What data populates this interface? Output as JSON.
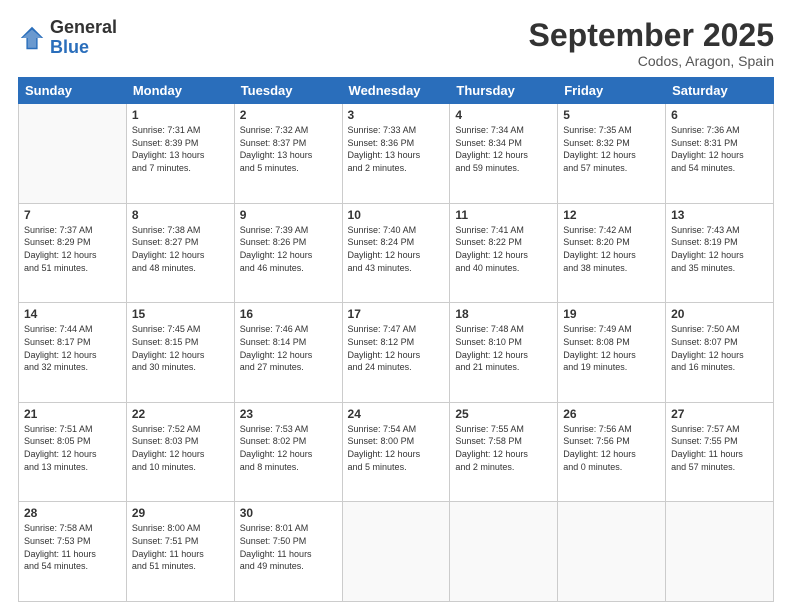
{
  "logo": {
    "general": "General",
    "blue": "Blue"
  },
  "header": {
    "month": "September 2025",
    "location": "Codos, Aragon, Spain"
  },
  "weekdays": [
    "Sunday",
    "Monday",
    "Tuesday",
    "Wednesday",
    "Thursday",
    "Friday",
    "Saturday"
  ],
  "weeks": [
    [
      {
        "day": "",
        "info": ""
      },
      {
        "day": "1",
        "info": "Sunrise: 7:31 AM\nSunset: 8:39 PM\nDaylight: 13 hours\nand 7 minutes."
      },
      {
        "day": "2",
        "info": "Sunrise: 7:32 AM\nSunset: 8:37 PM\nDaylight: 13 hours\nand 5 minutes."
      },
      {
        "day": "3",
        "info": "Sunrise: 7:33 AM\nSunset: 8:36 PM\nDaylight: 13 hours\nand 2 minutes."
      },
      {
        "day": "4",
        "info": "Sunrise: 7:34 AM\nSunset: 8:34 PM\nDaylight: 12 hours\nand 59 minutes."
      },
      {
        "day": "5",
        "info": "Sunrise: 7:35 AM\nSunset: 8:32 PM\nDaylight: 12 hours\nand 57 minutes."
      },
      {
        "day": "6",
        "info": "Sunrise: 7:36 AM\nSunset: 8:31 PM\nDaylight: 12 hours\nand 54 minutes."
      }
    ],
    [
      {
        "day": "7",
        "info": "Sunrise: 7:37 AM\nSunset: 8:29 PM\nDaylight: 12 hours\nand 51 minutes."
      },
      {
        "day": "8",
        "info": "Sunrise: 7:38 AM\nSunset: 8:27 PM\nDaylight: 12 hours\nand 48 minutes."
      },
      {
        "day": "9",
        "info": "Sunrise: 7:39 AM\nSunset: 8:26 PM\nDaylight: 12 hours\nand 46 minutes."
      },
      {
        "day": "10",
        "info": "Sunrise: 7:40 AM\nSunset: 8:24 PM\nDaylight: 12 hours\nand 43 minutes."
      },
      {
        "day": "11",
        "info": "Sunrise: 7:41 AM\nSunset: 8:22 PM\nDaylight: 12 hours\nand 40 minutes."
      },
      {
        "day": "12",
        "info": "Sunrise: 7:42 AM\nSunset: 8:20 PM\nDaylight: 12 hours\nand 38 minutes."
      },
      {
        "day": "13",
        "info": "Sunrise: 7:43 AM\nSunset: 8:19 PM\nDaylight: 12 hours\nand 35 minutes."
      }
    ],
    [
      {
        "day": "14",
        "info": "Sunrise: 7:44 AM\nSunset: 8:17 PM\nDaylight: 12 hours\nand 32 minutes."
      },
      {
        "day": "15",
        "info": "Sunrise: 7:45 AM\nSunset: 8:15 PM\nDaylight: 12 hours\nand 30 minutes."
      },
      {
        "day": "16",
        "info": "Sunrise: 7:46 AM\nSunset: 8:14 PM\nDaylight: 12 hours\nand 27 minutes."
      },
      {
        "day": "17",
        "info": "Sunrise: 7:47 AM\nSunset: 8:12 PM\nDaylight: 12 hours\nand 24 minutes."
      },
      {
        "day": "18",
        "info": "Sunrise: 7:48 AM\nSunset: 8:10 PM\nDaylight: 12 hours\nand 21 minutes."
      },
      {
        "day": "19",
        "info": "Sunrise: 7:49 AM\nSunset: 8:08 PM\nDaylight: 12 hours\nand 19 minutes."
      },
      {
        "day": "20",
        "info": "Sunrise: 7:50 AM\nSunset: 8:07 PM\nDaylight: 12 hours\nand 16 minutes."
      }
    ],
    [
      {
        "day": "21",
        "info": "Sunrise: 7:51 AM\nSunset: 8:05 PM\nDaylight: 12 hours\nand 13 minutes."
      },
      {
        "day": "22",
        "info": "Sunrise: 7:52 AM\nSunset: 8:03 PM\nDaylight: 12 hours\nand 10 minutes."
      },
      {
        "day": "23",
        "info": "Sunrise: 7:53 AM\nSunset: 8:02 PM\nDaylight: 12 hours\nand 8 minutes."
      },
      {
        "day": "24",
        "info": "Sunrise: 7:54 AM\nSunset: 8:00 PM\nDaylight: 12 hours\nand 5 minutes."
      },
      {
        "day": "25",
        "info": "Sunrise: 7:55 AM\nSunset: 7:58 PM\nDaylight: 12 hours\nand 2 minutes."
      },
      {
        "day": "26",
        "info": "Sunrise: 7:56 AM\nSunset: 7:56 PM\nDaylight: 12 hours\nand 0 minutes."
      },
      {
        "day": "27",
        "info": "Sunrise: 7:57 AM\nSunset: 7:55 PM\nDaylight: 11 hours\nand 57 minutes."
      }
    ],
    [
      {
        "day": "28",
        "info": "Sunrise: 7:58 AM\nSunset: 7:53 PM\nDaylight: 11 hours\nand 54 minutes."
      },
      {
        "day": "29",
        "info": "Sunrise: 8:00 AM\nSunset: 7:51 PM\nDaylight: 11 hours\nand 51 minutes."
      },
      {
        "day": "30",
        "info": "Sunrise: 8:01 AM\nSunset: 7:50 PM\nDaylight: 11 hours\nand 49 minutes."
      },
      {
        "day": "",
        "info": ""
      },
      {
        "day": "",
        "info": ""
      },
      {
        "day": "",
        "info": ""
      },
      {
        "day": "",
        "info": ""
      }
    ]
  ]
}
